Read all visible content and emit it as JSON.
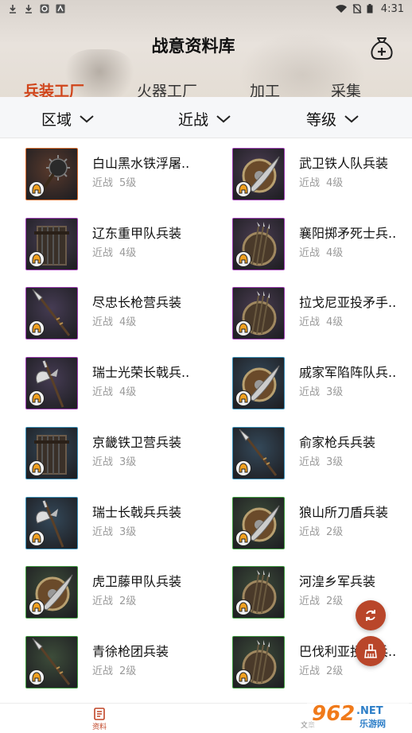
{
  "status_bar": {
    "time": "4:31"
  },
  "header": {
    "title": "战意资料库",
    "bag_icon": "money-bag-plus-icon"
  },
  "main_tabs": [
    {
      "label": "兵装工厂",
      "active": true
    },
    {
      "label": "火器工厂",
      "active": false
    },
    {
      "label": "加工",
      "active": false
    },
    {
      "label": "采集",
      "active": false
    }
  ],
  "filters": [
    {
      "label": "区域"
    },
    {
      "label": "近战"
    },
    {
      "label": "等级"
    }
  ],
  "items": [
    {
      "name": "白山黑水铁浮屠..",
      "type": "近战",
      "level": "5级",
      "frame": "#d86a2c",
      "bg": "#5a3a2c",
      "weapon": "mace"
    },
    {
      "name": "武卫铁人队兵装",
      "type": "近战",
      "level": "4级",
      "frame": "#9a3bb0",
      "bg": "#4b3d52",
      "weapon": "shield-sword"
    },
    {
      "name": "辽东重甲队兵装",
      "type": "近战",
      "level": "4级",
      "frame": "#9a3bb0",
      "bg": "#4a3f55",
      "weapon": "rack"
    },
    {
      "name": "襄阳掷矛死士兵..",
      "type": "近战",
      "level": "4级",
      "frame": "#9a3bb0",
      "bg": "#4b3d52",
      "weapon": "shield-javelins"
    },
    {
      "name": "尽忠长枪营兵装",
      "type": "近战",
      "level": "4级",
      "frame": "#9a3bb0",
      "bg": "#463c54",
      "weapon": "spear"
    },
    {
      "name": "拉戈尼亚投矛手..",
      "type": "近战",
      "level": "4级",
      "frame": "#9a3bb0",
      "bg": "#4b3d52",
      "weapon": "shield-javelins"
    },
    {
      "name": "瑞士光荣长戟兵..",
      "type": "近战",
      "level": "4级",
      "frame": "#9a3bb0",
      "bg": "#463c54",
      "weapon": "halberd"
    },
    {
      "name": "戚家军陷阵队兵..",
      "type": "近战",
      "level": "3级",
      "frame": "#3a8fb8",
      "bg": "#34495a",
      "weapon": "shield-sword"
    },
    {
      "name": "京畿铁卫营兵装",
      "type": "近战",
      "level": "3级",
      "frame": "#3a8fb8",
      "bg": "#34495a",
      "weapon": "rack"
    },
    {
      "name": "俞家枪兵兵装",
      "type": "近战",
      "level": "3级",
      "frame": "#3a8fb8",
      "bg": "#34495a",
      "weapon": "spear"
    },
    {
      "name": "瑞士长戟兵兵装",
      "type": "近战",
      "level": "3级",
      "frame": "#3a8fb8",
      "bg": "#34495a",
      "weapon": "halberd"
    },
    {
      "name": "狼山所刀盾兵装",
      "type": "近战",
      "level": "2级",
      "frame": "#3f9b3f",
      "bg": "#3d4d3a",
      "weapon": "shield-sword"
    },
    {
      "name": "虎卫藤甲队兵装",
      "type": "近战",
      "level": "2级",
      "frame": "#3f9b3f",
      "bg": "#3d4d3a",
      "weapon": "shield-sword"
    },
    {
      "name": "河湟乡军兵装",
      "type": "近战",
      "level": "2级",
      "frame": "#3f9b3f",
      "bg": "#3d4d3a",
      "weapon": "shield-javelins"
    },
    {
      "name": "青徐枪团兵装",
      "type": "近战",
      "level": "2级",
      "frame": "#3f9b3f",
      "bg": "#3d4d3a",
      "weapon": "spear"
    },
    {
      "name": "巴伐利亚投矛兵..",
      "type": "近战",
      "level": "2级",
      "frame": "#3f9b3f",
      "bg": "#3d4d3a",
      "weapon": "shield-javelins"
    }
  ],
  "fabs": {
    "refresh_icon": "refresh-icon",
    "clean_icon": "broom-icon"
  },
  "bottom_nav": [
    {
      "label": "资料",
      "active": true
    },
    {
      "label": "文章",
      "active": false
    }
  ],
  "watermark": {
    "brand": "962",
    "suffix": ".NET",
    "sub": "乐游网"
  },
  "colors": {
    "accent": "#d0451b",
    "fab": "#b9462a"
  }
}
